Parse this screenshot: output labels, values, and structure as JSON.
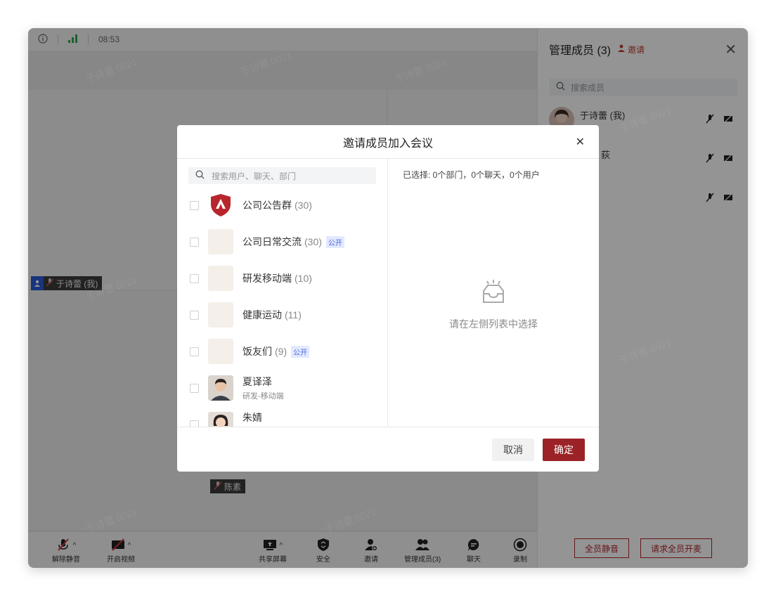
{
  "status": {
    "time": "08:53"
  },
  "stage": {
    "self_name": "于诗蕾 (我)",
    "other_name": "陈素"
  },
  "toolbar": {
    "unmute": "解除静音",
    "start_video": "开启视频",
    "share": "共享屏幕",
    "security": "安全",
    "invite": "邀请",
    "manage": "管理成员(3)",
    "chat": "聊天",
    "record": "录制"
  },
  "side_panel": {
    "title": "管理成员 (3)",
    "invite": "邀请",
    "search_placeholder": "搜索成员",
    "members": [
      {
        "name": "于诗蕾 (我)"
      },
      {
        "name": "荻"
      },
      {
        "name": ""
      }
    ],
    "mute_all": "全员静音",
    "request_unmute": "请求全员开麦"
  },
  "dialog": {
    "title": "邀请成员加入会议",
    "search_placeholder": "搜索用户、聊天、部门",
    "selected_summary": "已选择: 0个部门，0个聊天，0个用户",
    "empty_text": "请在左侧列表中选择",
    "public_tag": "公开",
    "items": [
      {
        "name": "公司公告群",
        "count": "(30)",
        "sub": ""
      },
      {
        "name": "公司日常交流",
        "count": "(30)",
        "sub": ""
      },
      {
        "name": "研发移动端",
        "count": "(10)",
        "sub": ""
      },
      {
        "name": "健康运动",
        "count": "(11)",
        "sub": ""
      },
      {
        "name": "饭友们",
        "count": "(9)",
        "sub": ""
      },
      {
        "name": "夏译泽",
        "count": "",
        "sub": "研发-移动端"
      },
      {
        "name": "朱婧",
        "count": "",
        "sub": ""
      }
    ],
    "cancel": "取消",
    "confirm": "确定"
  },
  "colors": {
    "accent": "#9b2226",
    "link_blue": "#4b6ae0"
  },
  "watermark": "于诗蕾 0021"
}
